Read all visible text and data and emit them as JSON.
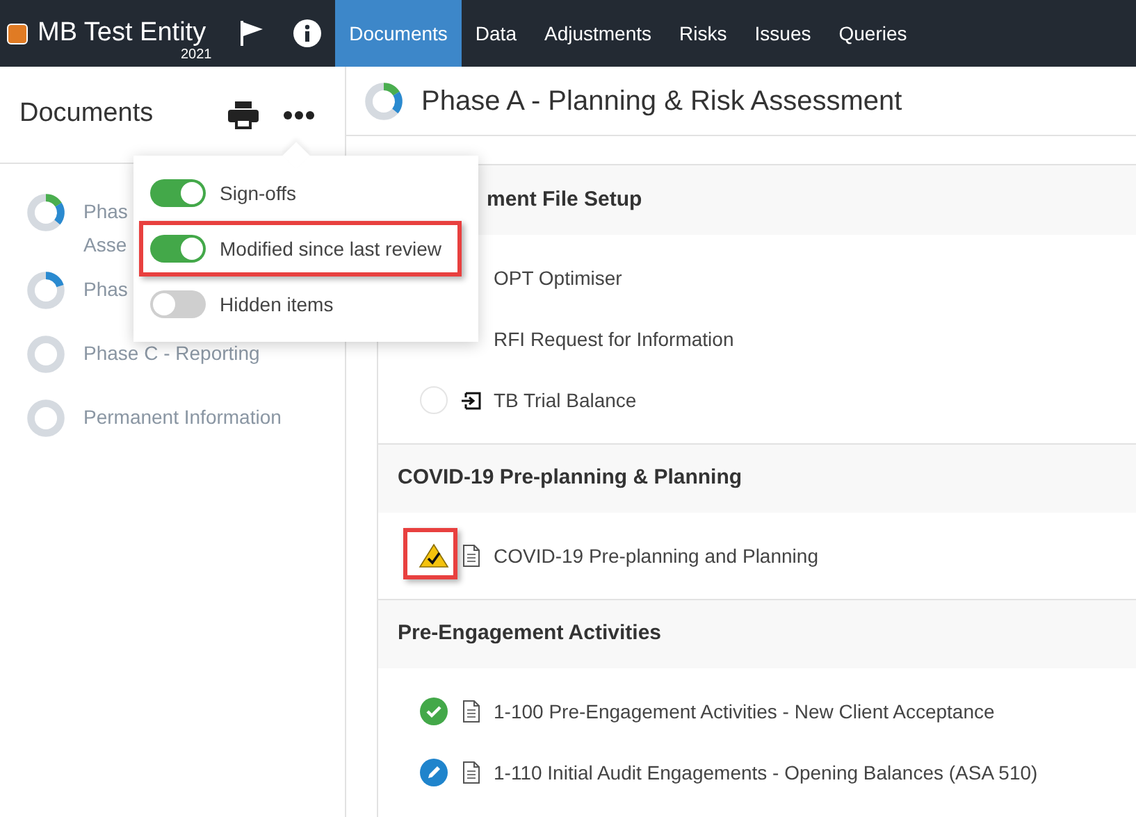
{
  "topbar": {
    "entity": "MB Test Entity",
    "year": "2021",
    "tabs": [
      {
        "label": "Documents",
        "selected": true
      },
      {
        "label": "Data",
        "selected": false
      },
      {
        "label": "Adjustments",
        "selected": false
      },
      {
        "label": "Risks",
        "selected": false
      },
      {
        "label": "Issues",
        "selected": false
      },
      {
        "label": "Queries",
        "selected": false
      }
    ]
  },
  "sidebar": {
    "title": "Documents",
    "items": [
      {
        "lines": [
          "Phas",
          "Asse"
        ],
        "kind": "mixed"
      },
      {
        "lines": [
          "Phas"
        ],
        "kind": "started"
      },
      {
        "lines": [
          "Phase C - Reporting"
        ],
        "kind": "none"
      },
      {
        "lines": [
          "Permanent Information"
        ],
        "kind": "none"
      }
    ]
  },
  "menu": {
    "toggles": [
      {
        "label": "Sign-offs",
        "on": true,
        "highlighted": false
      },
      {
        "label": "Modified since last review",
        "on": true,
        "highlighted": true
      },
      {
        "label": "Hidden items",
        "on": false,
        "highlighted": false
      }
    ]
  },
  "main": {
    "title": "Phase A - Planning & Risk Assessment",
    "kind": "mixed",
    "sections": [
      {
        "title": "ment File Setup",
        "rows": [
          {
            "label": "OPT Optimiser",
            "highlighted": false
          },
          {
            "label": "RFI Request for Information",
            "highlighted": false
          },
          {
            "kind": "empty",
            "file": {
              "kind": "import"
            },
            "label": "TB Trial Balance",
            "highlighted": false
          }
        ]
      },
      {
        "title": "COVID-19 Pre-planning & Planning",
        "rows": [
          {
            "kind": "warning",
            "file": {
              "kind": "document"
            },
            "label": "COVID-19 Pre-planning and Planning",
            "highlighted": true
          }
        ]
      },
      {
        "title": "Pre-Engagement Activities",
        "rows": [
          {
            "kind": "done",
            "file": {
              "kind": "document"
            },
            "label": "1-100 Pre-Engagement Activities - New Client Acceptance",
            "highlighted": false
          },
          {
            "kind": "edit",
            "file": {
              "kind": "document"
            },
            "label": "1-110 Initial Audit Engagements - Opening Balances (ASA 510)",
            "highlighted": false
          }
        ]
      }
    ]
  }
}
